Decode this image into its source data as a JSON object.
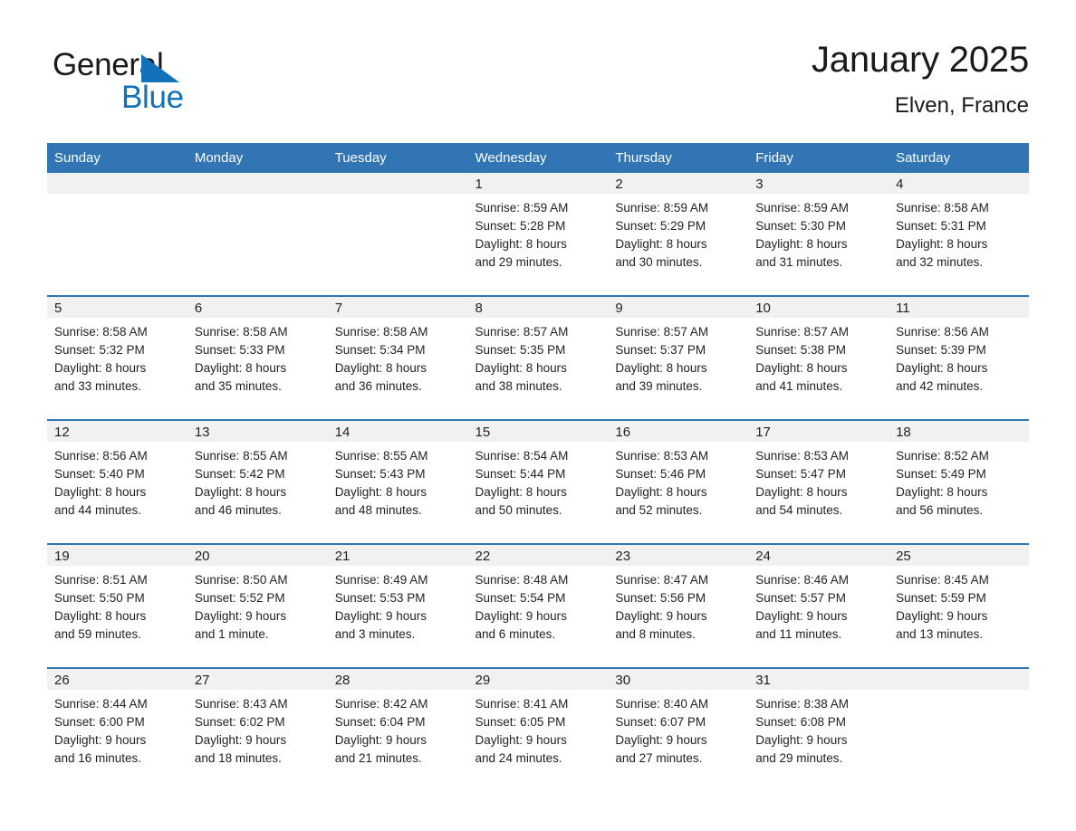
{
  "logo": {
    "word_one": "General",
    "word_two": "Blue",
    "triangle_color": "#1271bb",
    "text_color": "#1a1a1a"
  },
  "header": {
    "title": "January 2025",
    "subtitle": "Elven, France"
  },
  "theme": {
    "header_blue": "#3175b4",
    "day_band_gray": "#f1f1f1",
    "divider_blue": "#3175b4",
    "text": "#231f20"
  },
  "weekday_headers": [
    "Sunday",
    "Monday",
    "Tuesday",
    "Wednesday",
    "Thursday",
    "Friday",
    "Saturday"
  ],
  "weeks": [
    [
      {
        "empty": true
      },
      {
        "empty": true
      },
      {
        "empty": true
      },
      {
        "day": "1",
        "line1": "Sunrise: 8:59 AM",
        "line2": "Sunset: 5:28 PM",
        "line3": "Daylight: 8 hours",
        "line4": "and 29 minutes."
      },
      {
        "day": "2",
        "line1": "Sunrise: 8:59 AM",
        "line2": "Sunset: 5:29 PM",
        "line3": "Daylight: 8 hours",
        "line4": "and 30 minutes."
      },
      {
        "day": "3",
        "line1": "Sunrise: 8:59 AM",
        "line2": "Sunset: 5:30 PM",
        "line3": "Daylight: 8 hours",
        "line4": "and 31 minutes."
      },
      {
        "day": "4",
        "line1": "Sunrise: 8:58 AM",
        "line2": "Sunset: 5:31 PM",
        "line3": "Daylight: 8 hours",
        "line4": "and 32 minutes."
      }
    ],
    [
      {
        "day": "5",
        "line1": "Sunrise: 8:58 AM",
        "line2": "Sunset: 5:32 PM",
        "line3": "Daylight: 8 hours",
        "line4": "and 33 minutes."
      },
      {
        "day": "6",
        "line1": "Sunrise: 8:58 AM",
        "line2": "Sunset: 5:33 PM",
        "line3": "Daylight: 8 hours",
        "line4": "and 35 minutes."
      },
      {
        "day": "7",
        "line1": "Sunrise: 8:58 AM",
        "line2": "Sunset: 5:34 PM",
        "line3": "Daylight: 8 hours",
        "line4": "and 36 minutes."
      },
      {
        "day": "8",
        "line1": "Sunrise: 8:57 AM",
        "line2": "Sunset: 5:35 PM",
        "line3": "Daylight: 8 hours",
        "line4": "and 38 minutes."
      },
      {
        "day": "9",
        "line1": "Sunrise: 8:57 AM",
        "line2": "Sunset: 5:37 PM",
        "line3": "Daylight: 8 hours",
        "line4": "and 39 minutes."
      },
      {
        "day": "10",
        "line1": "Sunrise: 8:57 AM",
        "line2": "Sunset: 5:38 PM",
        "line3": "Daylight: 8 hours",
        "line4": "and 41 minutes."
      },
      {
        "day": "11",
        "line1": "Sunrise: 8:56 AM",
        "line2": "Sunset: 5:39 PM",
        "line3": "Daylight: 8 hours",
        "line4": "and 42 minutes."
      }
    ],
    [
      {
        "day": "12",
        "line1": "Sunrise: 8:56 AM",
        "line2": "Sunset: 5:40 PM",
        "line3": "Daylight: 8 hours",
        "line4": "and 44 minutes."
      },
      {
        "day": "13",
        "line1": "Sunrise: 8:55 AM",
        "line2": "Sunset: 5:42 PM",
        "line3": "Daylight: 8 hours",
        "line4": "and 46 minutes."
      },
      {
        "day": "14",
        "line1": "Sunrise: 8:55 AM",
        "line2": "Sunset: 5:43 PM",
        "line3": "Daylight: 8 hours",
        "line4": "and 48 minutes."
      },
      {
        "day": "15",
        "line1": "Sunrise: 8:54 AM",
        "line2": "Sunset: 5:44 PM",
        "line3": "Daylight: 8 hours",
        "line4": "and 50 minutes."
      },
      {
        "day": "16",
        "line1": "Sunrise: 8:53 AM",
        "line2": "Sunset: 5:46 PM",
        "line3": "Daylight: 8 hours",
        "line4": "and 52 minutes."
      },
      {
        "day": "17",
        "line1": "Sunrise: 8:53 AM",
        "line2": "Sunset: 5:47 PM",
        "line3": "Daylight: 8 hours",
        "line4": "and 54 minutes."
      },
      {
        "day": "18",
        "line1": "Sunrise: 8:52 AM",
        "line2": "Sunset: 5:49 PM",
        "line3": "Daylight: 8 hours",
        "line4": "and 56 minutes."
      }
    ],
    [
      {
        "day": "19",
        "line1": "Sunrise: 8:51 AM",
        "line2": "Sunset: 5:50 PM",
        "line3": "Daylight: 8 hours",
        "line4": "and 59 minutes."
      },
      {
        "day": "20",
        "line1": "Sunrise: 8:50 AM",
        "line2": "Sunset: 5:52 PM",
        "line3": "Daylight: 9 hours",
        "line4": "and 1 minute."
      },
      {
        "day": "21",
        "line1": "Sunrise: 8:49 AM",
        "line2": "Sunset: 5:53 PM",
        "line3": "Daylight: 9 hours",
        "line4": "and 3 minutes."
      },
      {
        "day": "22",
        "line1": "Sunrise: 8:48 AM",
        "line2": "Sunset: 5:54 PM",
        "line3": "Daylight: 9 hours",
        "line4": "and 6 minutes."
      },
      {
        "day": "23",
        "line1": "Sunrise: 8:47 AM",
        "line2": "Sunset: 5:56 PM",
        "line3": "Daylight: 9 hours",
        "line4": "and 8 minutes."
      },
      {
        "day": "24",
        "line1": "Sunrise: 8:46 AM",
        "line2": "Sunset: 5:57 PM",
        "line3": "Daylight: 9 hours",
        "line4": "and 11 minutes."
      },
      {
        "day": "25",
        "line1": "Sunrise: 8:45 AM",
        "line2": "Sunset: 5:59 PM",
        "line3": "Daylight: 9 hours",
        "line4": "and 13 minutes."
      }
    ],
    [
      {
        "day": "26",
        "line1": "Sunrise: 8:44 AM",
        "line2": "Sunset: 6:00 PM",
        "line3": "Daylight: 9 hours",
        "line4": "and 16 minutes."
      },
      {
        "day": "27",
        "line1": "Sunrise: 8:43 AM",
        "line2": "Sunset: 6:02 PM",
        "line3": "Daylight: 9 hours",
        "line4": "and 18 minutes."
      },
      {
        "day": "28",
        "line1": "Sunrise: 8:42 AM",
        "line2": "Sunset: 6:04 PM",
        "line3": "Daylight: 9 hours",
        "line4": "and 21 minutes."
      },
      {
        "day": "29",
        "line1": "Sunrise: 8:41 AM",
        "line2": "Sunset: 6:05 PM",
        "line3": "Daylight: 9 hours",
        "line4": "and 24 minutes."
      },
      {
        "day": "30",
        "line1": "Sunrise: 8:40 AM",
        "line2": "Sunset: 6:07 PM",
        "line3": "Daylight: 9 hours",
        "line4": "and 27 minutes."
      },
      {
        "day": "31",
        "line1": "Sunrise: 8:38 AM",
        "line2": "Sunset: 6:08 PM",
        "line3": "Daylight: 9 hours",
        "line4": "and 29 minutes."
      },
      {
        "empty": true
      }
    ]
  ]
}
